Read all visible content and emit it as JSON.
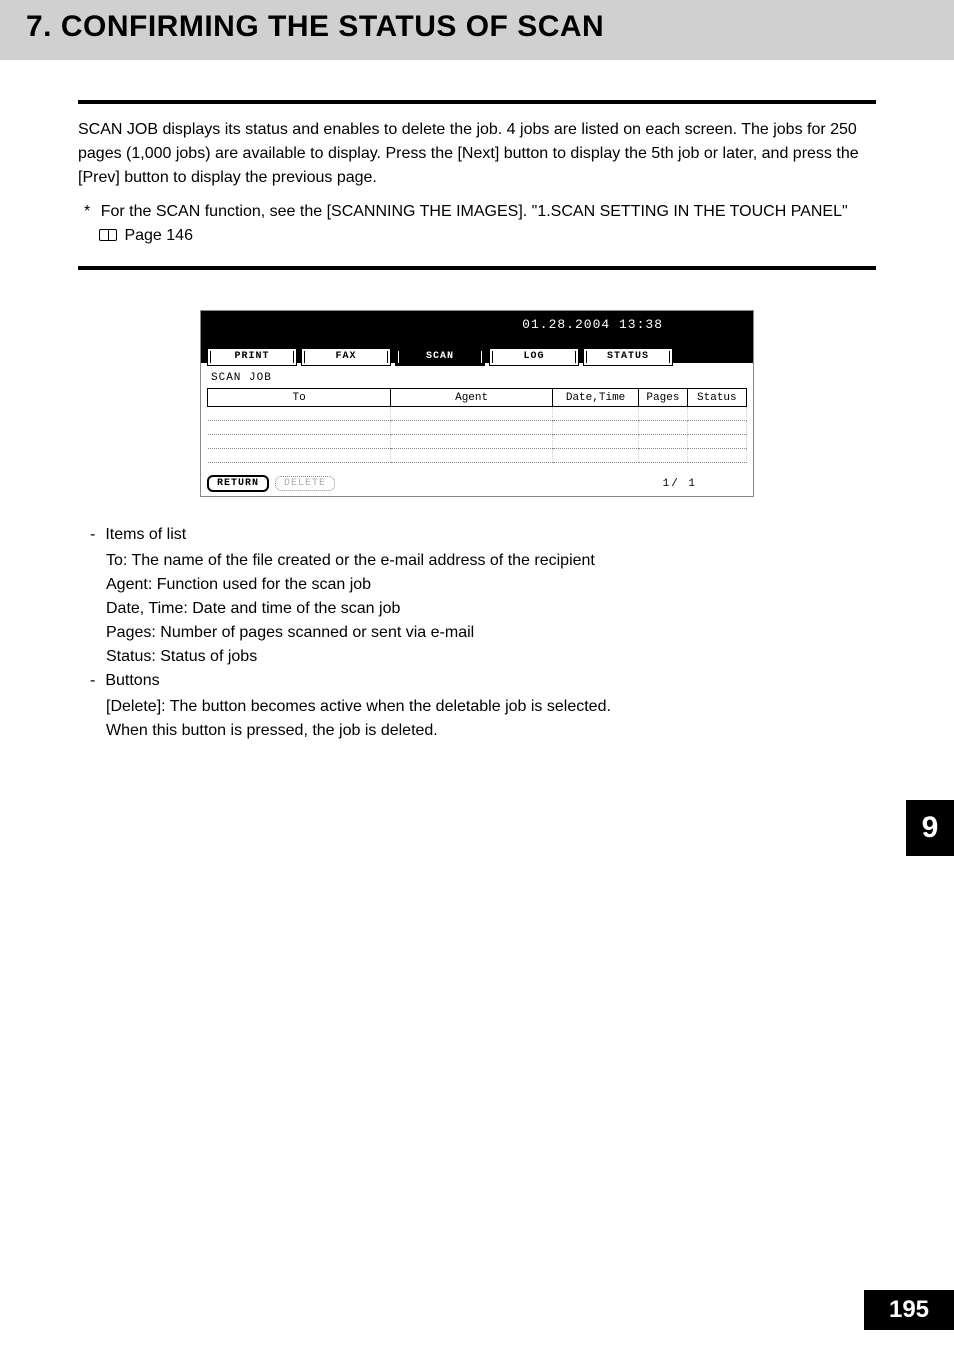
{
  "header": {
    "title": "7. CONFIRMING THE STATUS OF SCAN"
  },
  "body": {
    "para1": "SCAN JOB displays its status and enables to delete the job. 4 jobs are listed on each screen. The jobs for 250 pages (1,000 jobs) are available to display. Press the [Next] button to display the 5th job or later, and press the [Prev] button to display the previous page.",
    "note_star": "*",
    "note_text_a": "For the SCAN function, see the [SCANNING THE IMAGES]. \"1.SCAN SETTING IN THE TOUCH PANEL\"",
    "note_page": "Page 146"
  },
  "panel": {
    "clock": "01.28.2004 13:38",
    "tabs": {
      "print": "PRINT",
      "fax": "FAX",
      "scan": "SCAN",
      "log": "LOG",
      "status": "STATUS"
    },
    "label": "SCAN JOB",
    "cols": {
      "to": "To",
      "agent": "Agent",
      "dt": "Date,Time",
      "pages": "Pages",
      "status": "Status"
    },
    "buttons": {
      "return": "RETURN",
      "delete": "DELETE"
    },
    "page_ind": "1/  1"
  },
  "list": {
    "items_hdr": "Items of list",
    "to": "To: The name of the file created or the e-mail address of the recipient",
    "agent": "Agent: Function used for the scan job",
    "dt": "Date, Time: Date and time of the scan job",
    "pages": "Pages: Number of pages scanned or sent via e-mail",
    "status": "Status: Status of jobs",
    "buttons_hdr": "Buttons",
    "del1": "[Delete]: The button becomes active when the deletable job is selected.",
    "del2": "When this button is pressed, the job is deleted."
  },
  "side": {
    "chapter": "9",
    "page": "195"
  }
}
